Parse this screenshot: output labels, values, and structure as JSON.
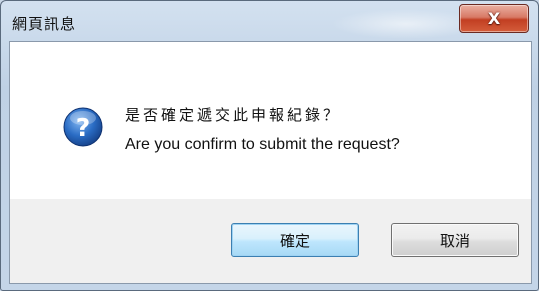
{
  "window": {
    "title": "網頁訊息",
    "close_glyph": "X"
  },
  "message": {
    "icon": "question-help-icon",
    "line_chinese": "是否確定遞交此申報紀錄？",
    "line_english": "Are you confirm to submit the request?"
  },
  "buttons": {
    "ok_label": "確定",
    "cancel_label": "取消"
  },
  "colors": {
    "close_button": "#c94a2e",
    "default_button_border": "#3c7fb1",
    "icon_blue": "#1f5fb4"
  }
}
